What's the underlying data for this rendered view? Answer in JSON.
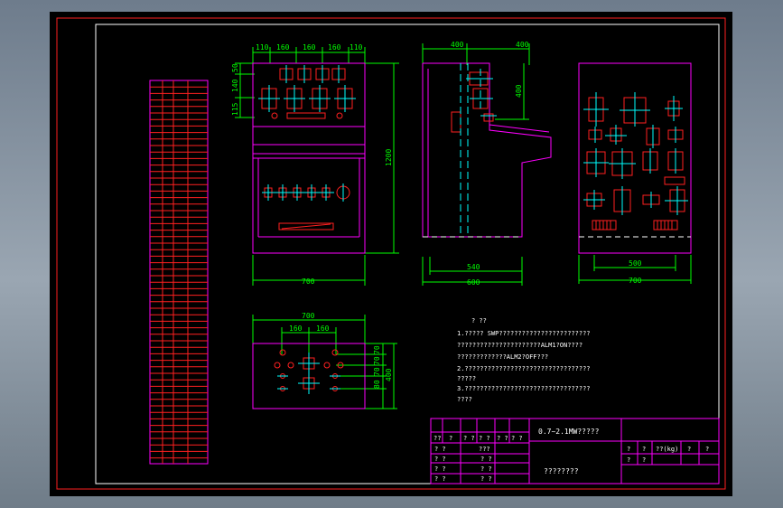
{
  "front_view": {
    "top_dims": [
      "110",
      "160",
      "160",
      "160",
      "110"
    ],
    "left_dims": [
      "50",
      "140",
      "115"
    ],
    "height_dim": "1200",
    "width_dim": "700"
  },
  "side_view": {
    "top_dims": [
      "400",
      "400"
    ],
    "inner_dim": "400",
    "bottom_dims": [
      "540",
      "600"
    ]
  },
  "back_view": {
    "bottom_dims": [
      "500",
      "700"
    ]
  },
  "top_view": {
    "width_dim": "700",
    "inner_dims": [
      "160",
      "160"
    ],
    "right_dims": [
      "70",
      "70",
      "70",
      "80"
    ],
    "height_dim": "400"
  },
  "notes": {
    "heading": "?     ??",
    "lines": [
      "1.?????  SWP????????????????????????",
      "  ??????????????????????ALM1?ON????",
      "  ?????????????ALM2?OFF???",
      "2.?????????????????????????????????",
      "  ?????",
      "3.?????????????????????????????????",
      "  ????"
    ]
  },
  "title_block": {
    "title": "0.7~2.1MW?????",
    "drawing_label": "????????",
    "left_header": [
      "??",
      "?",
      "? ?",
      "? ?",
      "? ?",
      "? ?"
    ],
    "left_rows": [
      [
        "? ?",
        "",
        "???"
      ],
      [
        "? ?",
        "",
        "? ?"
      ],
      [
        "? ?",
        "",
        "? ?"
      ],
      [
        "? ?",
        "",
        "? ?"
      ]
    ],
    "right_header": [
      "?",
      "?",
      "??(kg)",
      "?",
      "?"
    ],
    "right_row": [
      "?",
      "?"
    ]
  }
}
